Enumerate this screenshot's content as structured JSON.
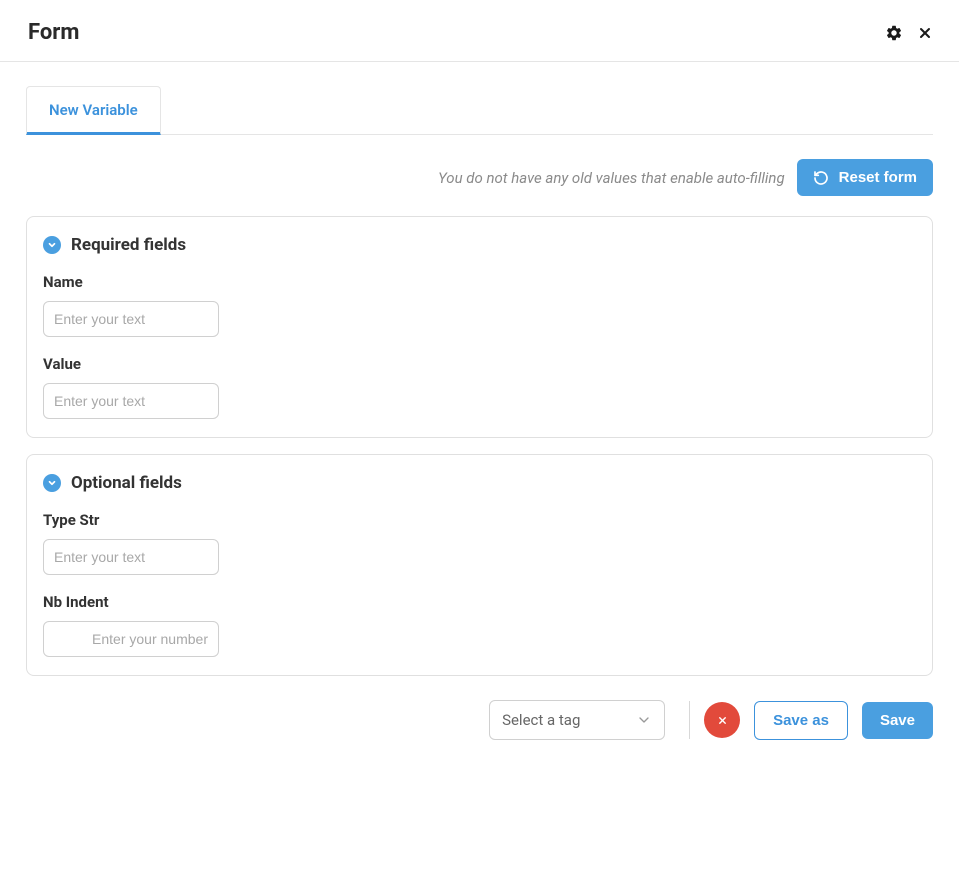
{
  "header": {
    "title": "Form"
  },
  "tabs": {
    "new_variable": "New Variable"
  },
  "info": {
    "no_values_text": "You do not have any old values that enable auto-filling",
    "reset_label": "Reset form"
  },
  "required_section": {
    "title": "Required fields",
    "name_label": "Name",
    "name_placeholder": "Enter your text",
    "value_label": "Value",
    "value_placeholder": "Enter your text"
  },
  "optional_section": {
    "title": "Optional fields",
    "type_str_label": "Type Str",
    "type_str_placeholder": "Enter your text",
    "nb_indent_label": "Nb Indent",
    "nb_indent_placeholder": "Enter your number"
  },
  "footer": {
    "tag_select_placeholder": "Select a tag",
    "save_as_label": "Save as",
    "save_label": "Save"
  }
}
